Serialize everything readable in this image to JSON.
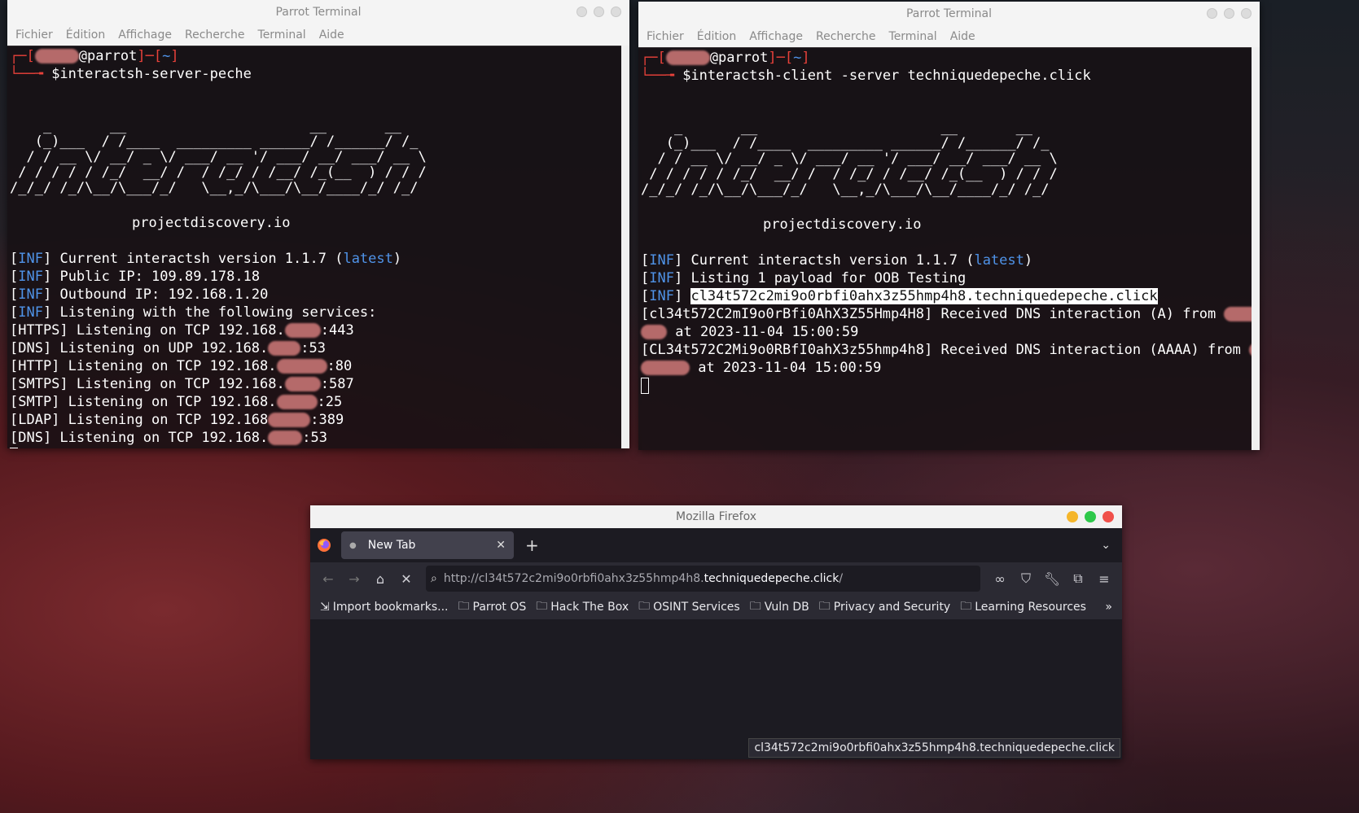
{
  "terminal_left": {
    "title": "Parrot Terminal",
    "menu": [
      "Fichier",
      "Édition",
      "Affichage",
      "Recherche",
      "Terminal",
      "Aide"
    ],
    "prompt_host": "@parrot",
    "prompt_dir": "~",
    "command": "$interactsh-server-peche",
    "ascii_art": [
      "    _       __                      __       __",
      "   (_)___  / /____  _________ ______/ /______/ /_",
      "  / / __ \\/ __/ _ \\/ ___/ __ '/ ___/ __/ ___/ __ \\",
      " / / / / / /_/  __/ /  / /_/ / /__/ /_(__  ) / / /",
      "/_/_/ /_/\\__/\\___/_/   \\__,_/\\___/\\__/____/_/ /_/"
    ],
    "brand": "projectdiscovery.io",
    "inf_tag": "INF",
    "lines": {
      "version": "Current interactsh version 1.1.7 (",
      "latest": "latest",
      "public_ip": "Public IP: 109.89.178.18",
      "outbound_ip": "Outbound IP: 192.168.1.20",
      "listening": "Listening with the following services:"
    },
    "services": [
      {
        "label": "[HTTPS] Listening on TCP 192.168.",
        "port": ":443"
      },
      {
        "label": "[DNS] Listening on UDP 192.168.",
        "port": ":53"
      },
      {
        "label": "[HTTP] Listening on TCP 192.168.",
        "port": ":80"
      },
      {
        "label": "[SMTPS] Listening on TCP 192.168.",
        "port": ":587"
      },
      {
        "label": "[SMTP] Listening on TCP 192.168.",
        "port": ":25"
      },
      {
        "label": "[LDAP] Listening on TCP 192.168",
        "port": ":389"
      },
      {
        "label": "[DNS] Listening on TCP 192.168.",
        "port": ":53"
      }
    ]
  },
  "terminal_right": {
    "title": "Parrot Terminal",
    "menu": [
      "Fichier",
      "Édition",
      "Affichage",
      "Recherche",
      "Terminal",
      "Aide"
    ],
    "prompt_host": "@parrot",
    "prompt_dir": "~",
    "command": "$interactsh-client -server techniquedepeche.click",
    "brand": "projectdiscovery.io",
    "inf_tag": "INF",
    "lines": {
      "version": "Current interactsh version 1.1.7 (",
      "latest": "latest",
      "listing": "Listing 1 payload for OOB Testing",
      "payload": "cl34t572c2mi9o0rbfi0ahx3z55hmp4h8.techniquedepeche.click",
      "dns_a": "[cl34t572C2mI9o0rBfi0AhX3Z55Hmp4H8] Received DNS interaction (A) from",
      "dns_a_time": " at 2023-11-04 15:00:59",
      "dns_aaaa": "[CL34t572C2Mi9o0RBfI0ahX3z55hmp4h8] Received DNS interaction (AAAA) from",
      "dns_aaaa_time": " at 2023-11-04 15:00:59"
    }
  },
  "firefox": {
    "title": "Mozilla Firefox",
    "tab_label": "New Tab",
    "url_prefix": "http://cl34t572c2mi9o0rbfi0ahx3z55hmp4h8.",
    "url_domain": "techniquedepeche.click",
    "url_suffix": "/",
    "bookmarks": [
      "Import bookmarks...",
      "Parrot OS",
      "Hack The Box",
      "OSINT Services",
      "Vuln DB",
      "Privacy and Security",
      "Learning Resources"
    ],
    "status_link": "cl34t572c2mi9o0rbfi0ahx3z55hmp4h8.techniquedepeche.click",
    "dot_colors": [
      "#f5b62b",
      "#2ec84a",
      "#f0504a"
    ]
  },
  "colors": {
    "prompt_red": "#e8413a",
    "inf_blue": "#4f93e8"
  }
}
